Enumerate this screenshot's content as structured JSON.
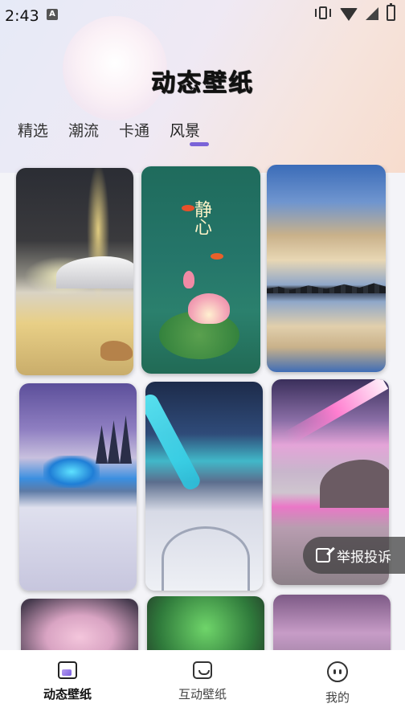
{
  "status_bar": {
    "time": "2:43",
    "badge": "A"
  },
  "app": {
    "title": "动态壁纸"
  },
  "tabs": [
    {
      "label": "精选"
    },
    {
      "label": "潮流"
    },
    {
      "label": "卡通"
    },
    {
      "label": "风景",
      "active": true
    }
  ],
  "wallpapers": {
    "poem": "静心"
  },
  "report_button": {
    "label": "举报投诉"
  },
  "bottom_nav": [
    {
      "label": "动态壁纸",
      "icon": "wallpaper-icon",
      "active": true
    },
    {
      "label": "互动壁纸",
      "icon": "interactive-icon"
    },
    {
      "label": "我的",
      "icon": "face-icon"
    }
  ],
  "colors": {
    "accent": "#7a63d8"
  }
}
